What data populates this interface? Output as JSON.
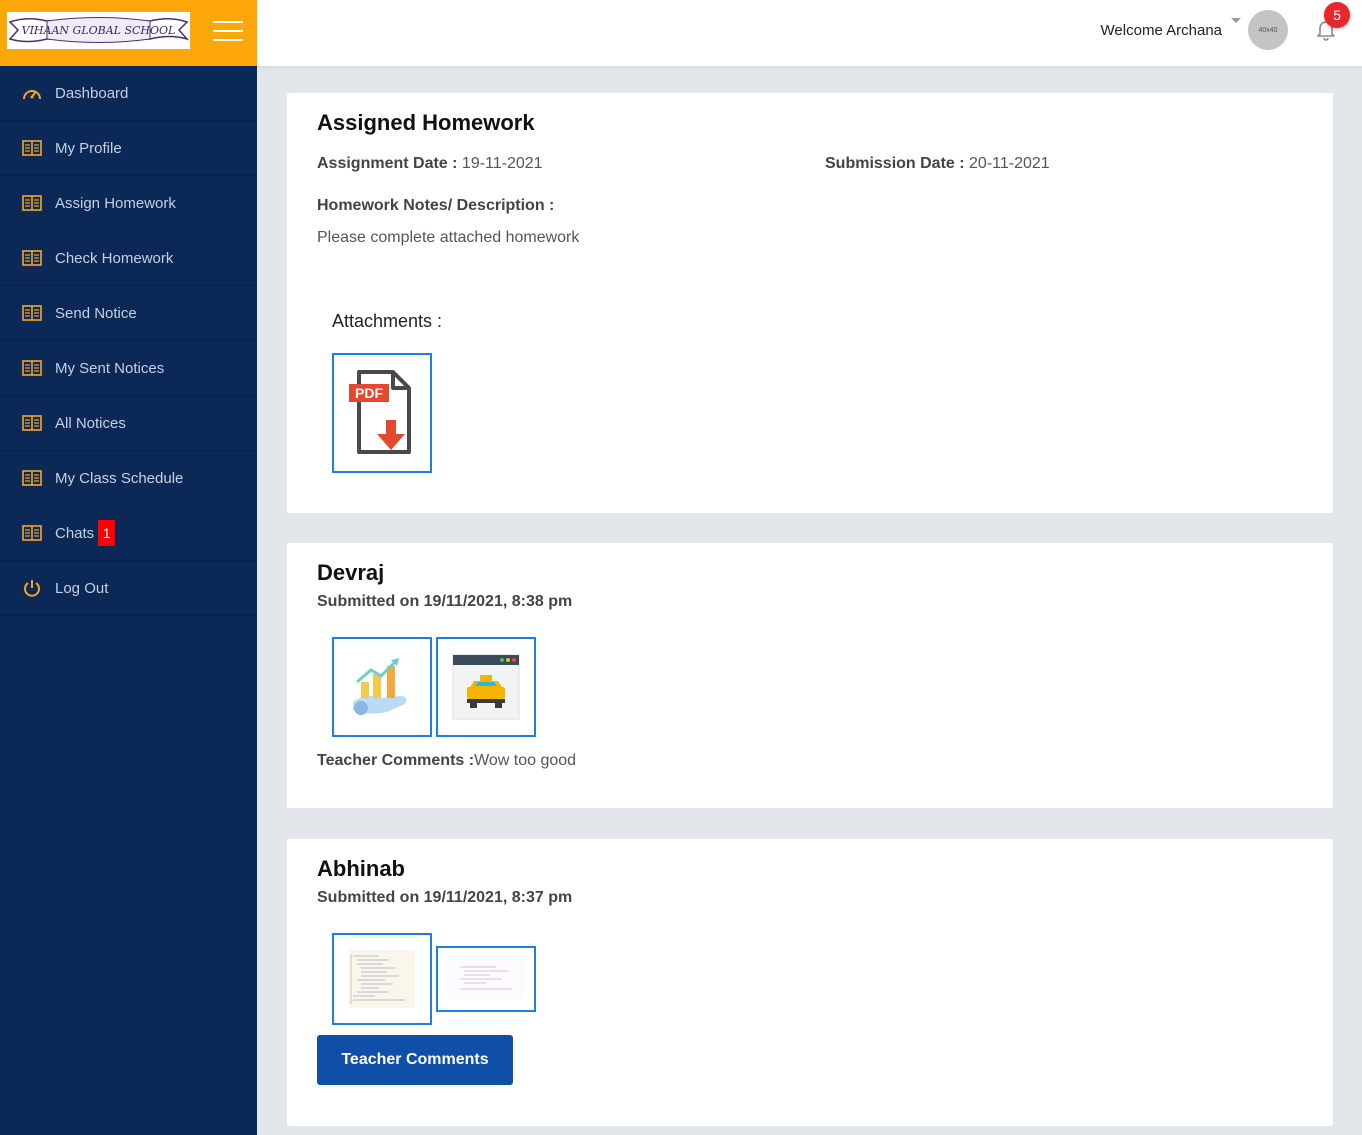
{
  "app": {
    "logo_text": "VIHAAN GLOBAL SCHOOL"
  },
  "sidebar": {
    "items": [
      {
        "label": "Dashboard",
        "icon": "dashboard-gauge-icon"
      },
      {
        "label": "My Profile",
        "icon": "book-icon"
      },
      {
        "label": "Assign Homework",
        "icon": "book-icon"
      },
      {
        "label": "Check Homework",
        "icon": "book-icon"
      },
      {
        "label": "Send Notice",
        "icon": "book-icon"
      },
      {
        "label": "My Sent Notices",
        "icon": "book-icon"
      },
      {
        "label": "All Notices",
        "icon": "book-icon"
      },
      {
        "label": "My Class Schedule",
        "icon": "book-icon"
      },
      {
        "label": "Chats",
        "icon": "book-icon",
        "badge": "1"
      },
      {
        "label": "Log Out",
        "icon": "power-icon"
      }
    ]
  },
  "header": {
    "welcome": "Welcome Archana",
    "avatar_placeholder": "40x40",
    "notification_count": "5"
  },
  "assignment": {
    "title": "Assigned Homework",
    "assignment_date_label": "Assignment Date :",
    "assignment_date": "19-11-2021",
    "submission_date_label": "Submission Date :",
    "submission_date": "20-11-2021",
    "notes_label": "Homework Notes/ Description :",
    "notes": "Please complete attached homework",
    "attachments_label": "Attachments :",
    "attachment_badge": "PDF"
  },
  "submissions": [
    {
      "student": "Devraj",
      "submitted": "Submitted on 19/11/2021, 8:38 pm",
      "comments_label": "Teacher Comments :",
      "comments": "Wow too good"
    },
    {
      "student": "Abhinab",
      "submitted": "Submitted on 19/11/2021, 8:37 pm",
      "button_label": "Teacher Comments"
    }
  ],
  "colors": {
    "sidebar_bg": "#0b2856",
    "brand_bg": "#fea70b",
    "accent_blue": "#1f7fe0",
    "button_blue": "#0f4fa8",
    "badge_red": "#e8262b"
  }
}
